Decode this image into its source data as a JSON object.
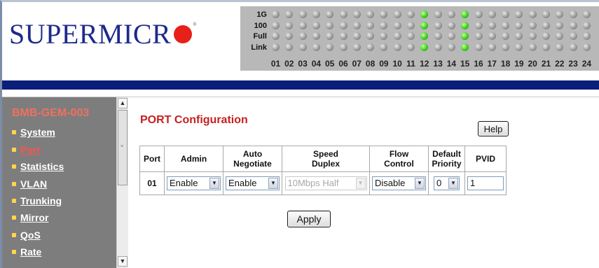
{
  "brand": {
    "logo_text": "SUPERMICR",
    "reg_mark": "®"
  },
  "led_panel": {
    "rows": [
      "1G",
      "100",
      "Full",
      "Link"
    ],
    "ports": [
      "01",
      "02",
      "03",
      "04",
      "05",
      "06",
      "07",
      "08",
      "09",
      "10",
      "11",
      "12",
      "13",
      "14",
      "15",
      "16",
      "17",
      "18",
      "19",
      "20",
      "21",
      "22",
      "23",
      "24"
    ],
    "active_ports": [
      "12",
      "15"
    ]
  },
  "sidebar": {
    "device_name": "BMB-GEM-003",
    "items": [
      {
        "label": "System"
      },
      {
        "label": "Port"
      },
      {
        "label": "Statistics"
      },
      {
        "label": "VLAN"
      },
      {
        "label": "Trunking"
      },
      {
        "label": "Mirror"
      },
      {
        "label": "QoS"
      },
      {
        "label": "Rate"
      }
    ],
    "active": "Port"
  },
  "main": {
    "title": "PORT Configuration",
    "help_label": "Help",
    "apply_label": "Apply",
    "table": {
      "headers": [
        "Port",
        "Admin",
        "Auto Negotiate",
        "Speed Duplex",
        "Flow Control",
        "Default Priority",
        "PVID"
      ],
      "row": {
        "port": "01",
        "admin": "Enable",
        "auto_negotiate": "Enable",
        "speed_duplex": "10Mbps Half",
        "flow_control": "Disable",
        "default_priority": "0",
        "pvid": "1"
      }
    }
  },
  "colors": {
    "brand_blue": "#1d2a8a",
    "logo_dot": "#e8201a",
    "header_bar": "#0a1e7a",
    "sidebar_bg": "#7d7d7d",
    "title_red": "#c82020",
    "led_on": "#3fcf22"
  }
}
